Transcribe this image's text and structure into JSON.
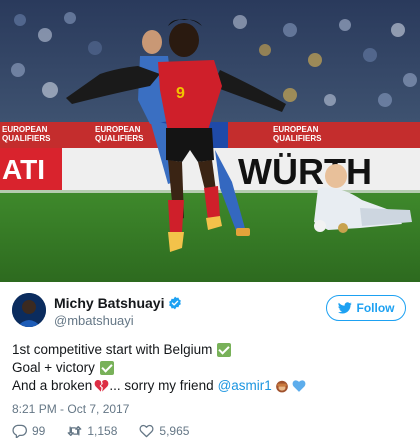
{
  "photo": {
    "banner_left": "EUROPEAN\nQUALIFIERS",
    "banner_right": "EUROPEAN\nQUALIFIERS",
    "ad_left": "ATI",
    "ad_right": "WÜRTH",
    "jersey_number": "9"
  },
  "tweet": {
    "display_name": "Michy Batshuayi",
    "handle": "@mbatshuayi",
    "follow_label": "Follow",
    "lines": {
      "line1": "1st competitive start with Belgium",
      "line2": "Goal + victory",
      "line3_before": "And a broken",
      "line3_after": "... sorry my friend",
      "mention": "@asmir1"
    },
    "timestamp": "8:21 PM - Oct 7, 2017",
    "replies": "99",
    "retweets": "1,158",
    "likes": "5,965"
  },
  "colors": {
    "twitter_blue": "#1da1f2",
    "mention_blue": "#1b95e0",
    "secondary_text": "#657786",
    "check_green": "#78b159",
    "heart_red": "#e0245e"
  },
  "icons": {
    "verified": "verified-badge-icon",
    "follow": "twitter-bird-icon",
    "reply": "reply-icon",
    "retweet": "retweet-icon",
    "like": "heart-icon"
  }
}
